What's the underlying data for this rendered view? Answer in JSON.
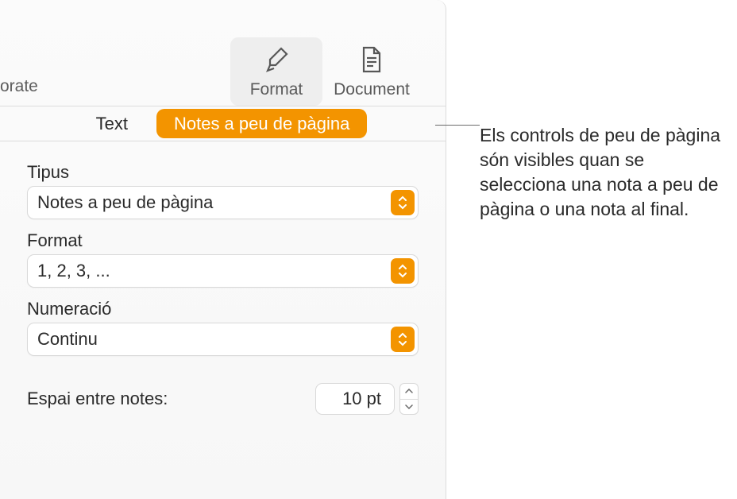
{
  "toolbar": {
    "left_partial": "orate",
    "format": {
      "label": "Format",
      "icon": "paintbrush-icon"
    },
    "document": {
      "label": "Document",
      "icon": "document-icon"
    }
  },
  "tabs": {
    "text": "Text",
    "footnotes": "Notes a peu de pàgina"
  },
  "form": {
    "type": {
      "label": "Tipus",
      "value": "Notes a peu de pàgina"
    },
    "format": {
      "label": "Format",
      "value": "1, 2, 3, ..."
    },
    "numbering": {
      "label": "Numeració",
      "value": "Continu"
    },
    "spacing": {
      "label": "Espai entre notes:",
      "value": "10 pt"
    }
  },
  "callout": "Els controls de peu de pàgina són visibles quan se selecciona una nota a peu de pàgina o una nota al final."
}
